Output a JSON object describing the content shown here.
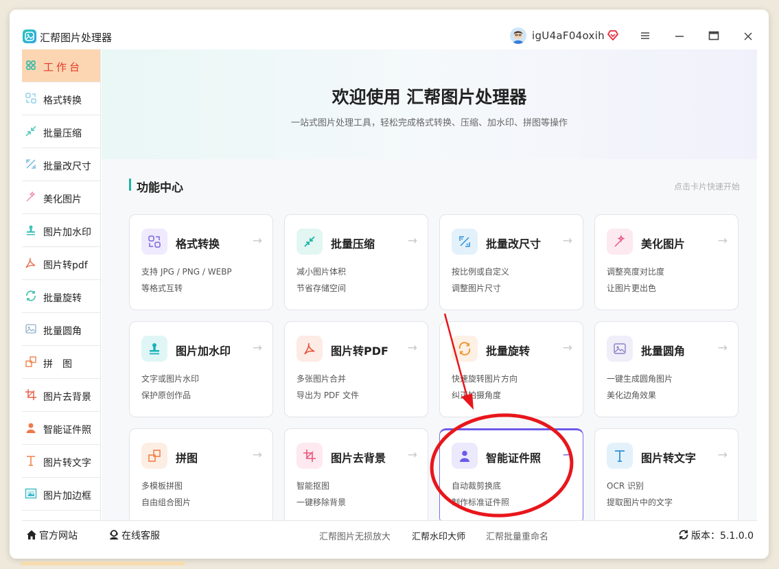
{
  "app": {
    "title": "汇帮图片处理器",
    "username": "igU4aF04oxih"
  },
  "sidebar": {
    "items": [
      {
        "label": "工作台",
        "icon": "grid-icon",
        "active": true
      },
      {
        "label": "格式转换",
        "icon": "convert-icon"
      },
      {
        "label": "批量压缩",
        "icon": "compress-icon"
      },
      {
        "label": "批量改尺寸",
        "icon": "resize-icon"
      },
      {
        "label": "美化图片",
        "icon": "beautify-icon"
      },
      {
        "label": "图片加水印",
        "icon": "watermark-icon"
      },
      {
        "label": "图片转pdf",
        "icon": "pdf-icon"
      },
      {
        "label": "批量旋转",
        "icon": "rotate-icon"
      },
      {
        "label": "批量圆角",
        "icon": "round-corner-icon"
      },
      {
        "label": "拼　图",
        "icon": "collage-icon"
      },
      {
        "label": "图片去背景",
        "icon": "crop-icon"
      },
      {
        "label": "智能证件照",
        "icon": "person-icon"
      },
      {
        "label": "图片转文字",
        "icon": "text-icon"
      },
      {
        "label": "图片加边框",
        "icon": "frame-icon"
      }
    ]
  },
  "hero": {
    "title": "欢迎使用 汇帮图片处理器",
    "subtitle": "一站式图片处理工具，轻松完成格式转换、压缩、加水印、拼图等操作"
  },
  "section": {
    "title": "功能中心",
    "hint": "点击卡片快速开始"
  },
  "cards": [
    {
      "title": "格式转换",
      "desc1": "支持 JPG / PNG / WEBP",
      "desc2": "等格式互转",
      "icon": "convert-icon"
    },
    {
      "title": "批量压缩",
      "desc1": "减小图片体积",
      "desc2": "节省存储空间",
      "icon": "compress-icon"
    },
    {
      "title": "批量改尺寸",
      "desc1": "按比例或自定义",
      "desc2": "调整图片尺寸",
      "icon": "resize-icon"
    },
    {
      "title": "美化图片",
      "desc1": "调整亮度对比度",
      "desc2": "让图片更出色",
      "icon": "beautify-icon"
    },
    {
      "title": "图片加水印",
      "desc1": "文字或图片水印",
      "desc2": "保护原创作品",
      "icon": "watermark-icon"
    },
    {
      "title": "图片转PDF",
      "desc1": "多张图片合并",
      "desc2": "导出为 PDF 文件",
      "icon": "pdf-icon"
    },
    {
      "title": "批量旋转",
      "desc1": "快速旋转图片方向",
      "desc2": "纠正拍摄角度",
      "icon": "rotate-icon"
    },
    {
      "title": "批量圆角",
      "desc1": "一键生成圆角图片",
      "desc2": "美化边角效果",
      "icon": "round-corner-icon"
    },
    {
      "title": "拼图",
      "desc1": "多模板拼图",
      "desc2": "自由组合图片",
      "icon": "collage-icon"
    },
    {
      "title": "图片去背景",
      "desc1": "智能抠图",
      "desc2": "一键移除背景",
      "icon": "crop-icon"
    },
    {
      "title": "智能证件照",
      "desc1": "自动裁剪换底",
      "desc2": "制作标准证件照",
      "icon": "person-icon"
    },
    {
      "title": "图片转文字",
      "desc1": "OCR 识别",
      "desc2": "提取图片中的文字",
      "icon": "text-icon"
    }
  ],
  "footer": {
    "website": "官方网站",
    "support": "在线客服",
    "link1": "汇帮图片无损放大",
    "link2": "汇帮水印大师",
    "link3": "汇帮批量重命名",
    "version_label": "版本：",
    "version": "5.1.0.0"
  },
  "colors": {
    "accent_teal": "#1bb5a6",
    "active_bg": "#fcd6b3",
    "active_text": "#e23a2a",
    "highlight_border": "#6b5bea",
    "annotation_red": "#e8161b"
  }
}
